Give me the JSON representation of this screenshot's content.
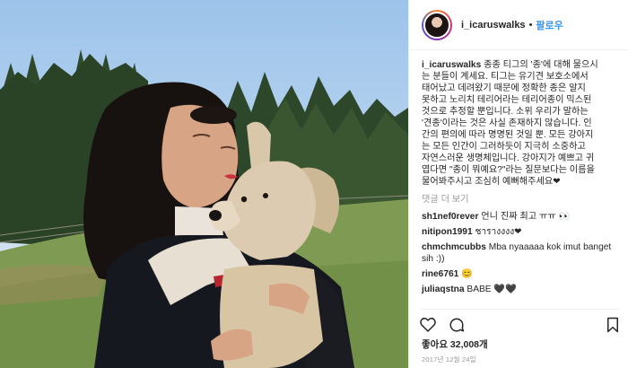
{
  "post": {
    "photo_alt": "woman hugging dog in park",
    "username": "i_icaruswalks",
    "separator": "•",
    "follow_label": "팔로우",
    "caption": {
      "username": "i_icaruswalks",
      "lines": [
        " 종종 티그의 '종'에 대해 물으시",
        "는 분들이 계세요. 티그는 유기견 보호소에서",
        "태어났고 데려왔기 때문에 정확한 종은 알지",
        "못하고 노리치 테리어라는 테리어종이 믹스된",
        "것으로 추정할 뿐입니다. 소위 우리가 말하는",
        "'견종'이라는 것은 사실 존재하지 않습니다. 인",
        "간의 편의에 따라 명명된 것일 뿐. 모든 강아지",
        "는 모든 인간이 그러하듯이 지극히 소중하고",
        "자연스러운 생명체입니다. 강아지가 예쁘고 귀",
        "엽다면 \"종이 뭐예요?\"라는 질문보다는 이름을",
        "물어봐주시고 조심히 예뻐해주세요❤"
      ]
    },
    "more_comments": "댓글 더 보기",
    "comments": [
      {
        "user": "sh1nef0rever",
        "text": "언니 진짜 최고 ㅠㅠ 👀"
      },
      {
        "user": "nitipon1991",
        "text": "ชารางงงง❤"
      },
      {
        "user": "chmchmcubbs",
        "text": "Mba nyaaaaa kok imut banget sih :))"
      },
      {
        "user": "rine6761",
        "text": "😊"
      },
      {
        "user": "juliaqstna",
        "text": "BABE 🖤🖤"
      }
    ],
    "actions": {
      "like_icon": "heart-icon",
      "comment_icon": "comment-icon",
      "save_icon": "bookmark-icon"
    },
    "likes_text": "좋아요 32,008개",
    "date_text": "2017년 12월 24일"
  }
}
